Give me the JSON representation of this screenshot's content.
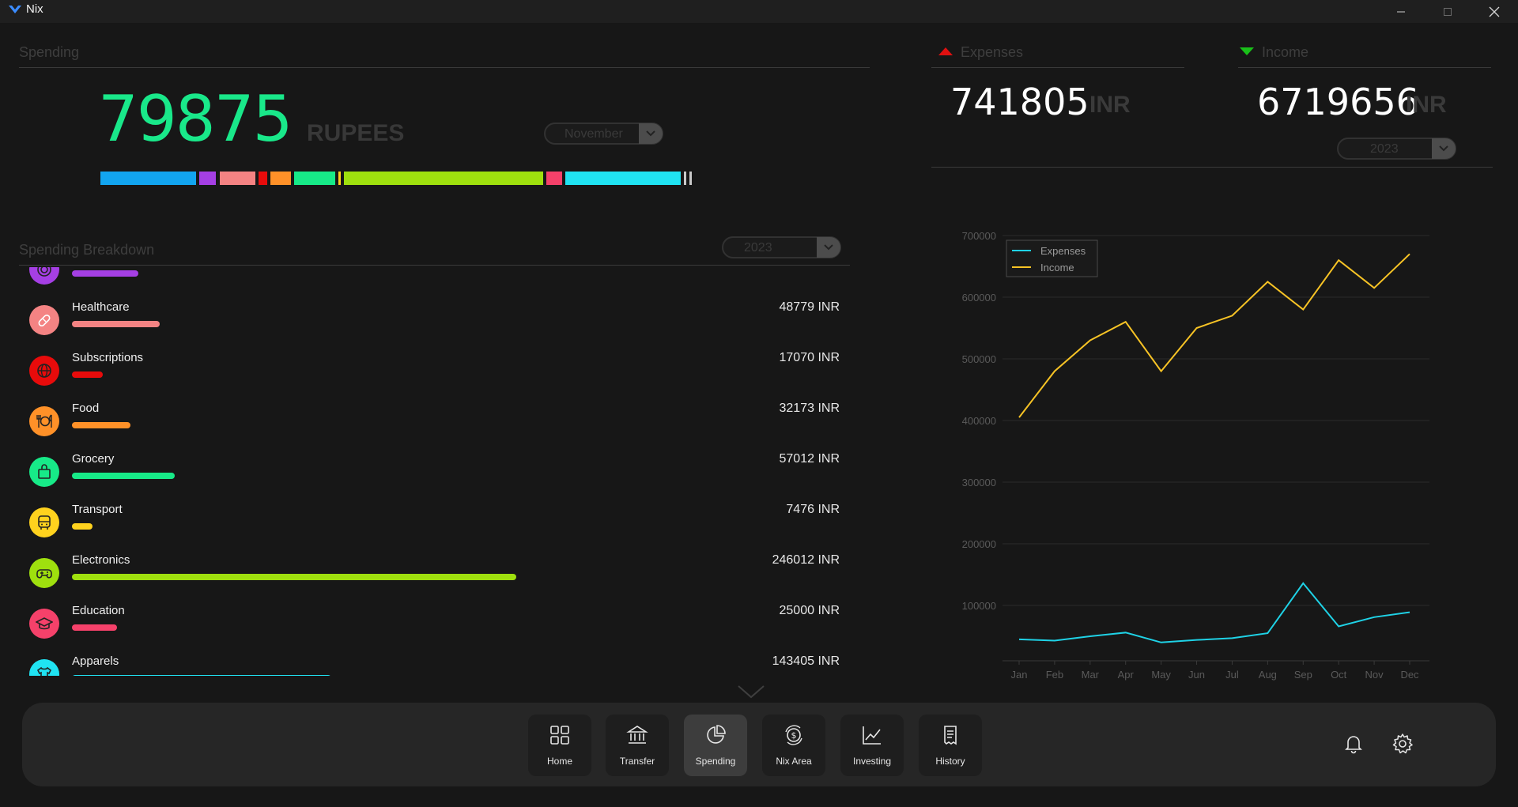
{
  "window": {
    "title": "Nix"
  },
  "spending": {
    "title": "Spending",
    "amount": "79875",
    "unit": "RUPEES",
    "month_select": "November",
    "segments": [
      {
        "color": "#12a5f0",
        "share": 0.1612
      },
      {
        "color": "#a53fe4",
        "share": 0.0335
      },
      {
        "color": "#f48383",
        "share": 0.0638
      },
      {
        "color": "#e80b0b",
        "share": 0.0191
      },
      {
        "color": "#ff9128",
        "share": 0.0399
      },
      {
        "color": "#17ea88",
        "share": 0.0718
      },
      {
        "color": "#ffd21e",
        "share": 0.0064
      },
      {
        "color": "#9fe00e",
        "share": 0.3317
      },
      {
        "color": "#f5416a",
        "share": 0.0303
      },
      {
        "color": "#20e3f2",
        "share": 0.1946
      },
      {
        "color": "#c9c9c9",
        "share": 0.0064
      },
      {
        "color": "#c9c9c9",
        "share": 0.0064
      }
    ]
  },
  "breakdown": {
    "title": "Spending Breakdown",
    "year_select": "2023",
    "items": [
      {
        "name": "",
        "amount": "",
        "color": "#a53fe4",
        "bar_fraction": 0.15,
        "icon": "bullseye-icon"
      },
      {
        "name": "Healthcare",
        "amount": "48779 INR",
        "color": "#f48383",
        "bar_fraction": 0.198,
        "icon": "bandage-icon"
      },
      {
        "name": "Subscriptions",
        "amount": "17070 INR",
        "color": "#e80b0b",
        "bar_fraction": 0.069,
        "icon": "globe-icon"
      },
      {
        "name": "Food",
        "amount": "32173 INR",
        "color": "#ff9128",
        "bar_fraction": 0.131,
        "icon": "utensils-icon"
      },
      {
        "name": "Grocery",
        "amount": "57012 INR",
        "color": "#17ea88",
        "bar_fraction": 0.232,
        "icon": "shopping-bag-icon"
      },
      {
        "name": "Transport",
        "amount": "7476 INR",
        "color": "#ffd21e",
        "bar_fraction": 0.03,
        "icon": "bus-icon"
      },
      {
        "name": "Electronics",
        "amount": "246012 INR",
        "color": "#9fe00e",
        "bar_fraction": 1.0,
        "icon": "gamepad-icon"
      },
      {
        "name": "Education",
        "amount": "25000 INR",
        "color": "#f5416a",
        "bar_fraction": 0.102,
        "icon": "graduation-cap-icon"
      },
      {
        "name": "Apparels",
        "amount": "143405 INR",
        "color": "#20e3f2",
        "bar_fraction": 0.583,
        "icon": "shirt-icon"
      }
    ]
  },
  "expenses": {
    "label": "Expenses",
    "amount": "741805",
    "unit": "INR"
  },
  "income": {
    "label": "Income",
    "amount": "6719656",
    "unit": "INR"
  },
  "year_select": "2023",
  "chart_data": {
    "type": "line",
    "categories": [
      "Jan",
      "Feb",
      "Mar",
      "Apr",
      "May",
      "Jun",
      "Jul",
      "Aug",
      "Sep",
      "Oct",
      "Nov",
      "Dec"
    ],
    "series": [
      {
        "name": "Expenses",
        "color": "#1fd2e6",
        "values": [
          45000,
          43000,
          50000,
          56000,
          40000,
          44000,
          47000,
          55000,
          136000,
          66000,
          81000,
          89000
        ]
      },
      {
        "name": "Income",
        "color": "#f7c325",
        "values": [
          405000,
          480000,
          530000,
          560000,
          480000,
          550000,
          570000,
          625000,
          580000,
          660000,
          615000,
          670000
        ]
      }
    ],
    "yticks": [
      "100000",
      "200000",
      "300000",
      "400000",
      "500000",
      "600000",
      "700000"
    ],
    "ylim": [
      0,
      700000
    ],
    "grid": true,
    "legend_position": "top-left"
  },
  "nav": {
    "items": [
      {
        "label": "Home",
        "icon": "grid-icon",
        "active": false
      },
      {
        "label": "Transfer",
        "icon": "bank-icon",
        "active": false
      },
      {
        "label": "Spending",
        "icon": "pie-chart-icon",
        "active": true
      },
      {
        "label": "Nix Area",
        "icon": "coin-exchange-icon",
        "active": false
      },
      {
        "label": "Investing",
        "icon": "line-chart-icon",
        "active": false
      },
      {
        "label": "History",
        "icon": "receipt-icon",
        "active": false
      }
    ],
    "bell_icon": "bell-icon",
    "settings_icon": "gear-icon"
  }
}
